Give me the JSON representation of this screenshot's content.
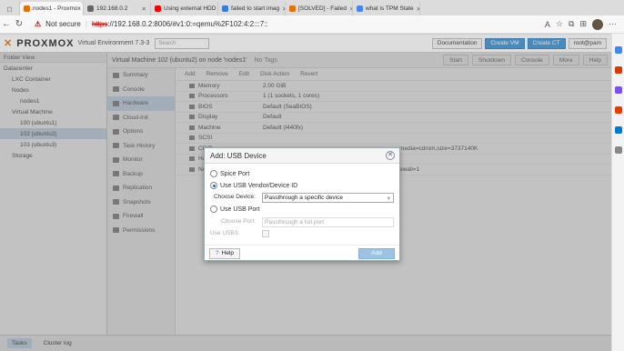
{
  "browser": {
    "tabs": [
      {
        "label": "nodes1 - Proxmox",
        "color": "#e57000"
      },
      {
        "label": "192.168.0.2",
        "color": "#666666"
      },
      {
        "label": "Using external HDD",
        "color": "#ff0000"
      },
      {
        "label": "failed to start imag",
        "color": "#3a7bd5"
      },
      {
        "label": "[SOLVED] - Failed",
        "color": "#e57000"
      },
      {
        "label": "what is TPM State",
        "color": "#4285f4"
      }
    ],
    "security_label": "Not secure",
    "url_https": "https",
    "url_rest": "://192.168.0.2:8006/#v1:0:=qemu%2F102:4:2:::7::"
  },
  "proxmox": {
    "logo_a": "PRO",
    "logo_b": "XMOX",
    "version": "Virtual Environment 7.3-3",
    "search_placeholder": "Search",
    "buttons": {
      "docs": "Documentation",
      "create_vm": "Create VM",
      "create_ct": "Create CT",
      "user": "root@pam"
    },
    "tree_header": "Folder View",
    "tree": [
      {
        "label": "Datacenter",
        "indent": 0
      },
      {
        "label": "LXC Container",
        "indent": 1
      },
      {
        "label": "Nodes",
        "indent": 1
      },
      {
        "label": "nodes1",
        "indent": 2
      },
      {
        "label": "Virtual Machine",
        "indent": 1
      },
      {
        "label": "100 (ubuntu1)",
        "indent": 2
      },
      {
        "label": "102 (ubuntu2)",
        "indent": 2,
        "selected": true
      },
      {
        "label": "103 (ubuntu3)",
        "indent": 2
      },
      {
        "label": "Storage",
        "indent": 1
      }
    ],
    "vm_title": "Virtual Machine 102 (ubuntu2) on node 'nodes1'",
    "no_tags": "No Tags",
    "vm_buttons": [
      "Start",
      "Shutdown",
      "Console",
      "More",
      "Help"
    ],
    "menu": [
      "Summary",
      "Console",
      "Hardware",
      "Cloud-Init",
      "Options",
      "Task History",
      "Monitor",
      "Backup",
      "Replication",
      "Snapshots",
      "Firewall",
      "Permissions"
    ],
    "menu_selected": 2,
    "toolbar": [
      "Add",
      "Remove",
      "Edit",
      "Disk Action",
      "Revert"
    ],
    "hardware": [
      {
        "k": "Memory",
        "v": "2.00 GiB"
      },
      {
        "k": "Processors",
        "v": "1 (1 sockets, 1 cores)"
      },
      {
        "k": "BIOS",
        "v": "Default (SeaBIOS)"
      },
      {
        "k": "Display",
        "v": "Default"
      },
      {
        "k": "Machine",
        "v": "Default (i440fx)"
      },
      {
        "k": "SCSI",
        "v": ""
      },
      {
        "k": "CD/D",
        "v": "media=cdrom,size=3737140K"
      },
      {
        "k": "Hard",
        "v": ""
      },
      {
        "k": "Netw",
        "v": "ewall=1"
      }
    ],
    "footer_tabs": [
      "Tasks",
      "Cluster log"
    ]
  },
  "dialog": {
    "title": "Add: USB Device",
    "opt_spice": "Spice Port",
    "opt_vendor": "Use USB Vendor/Device ID",
    "choose_device_label": "Choose Device:",
    "choose_device_value": "Passthrough a specific device",
    "opt_port": "Use USB Port",
    "choose_port_label": "Choose Port:",
    "choose_port_value": "Passthrough a full port",
    "usb3_label": "Use USB3:",
    "help": "Help",
    "add": "Add"
  }
}
